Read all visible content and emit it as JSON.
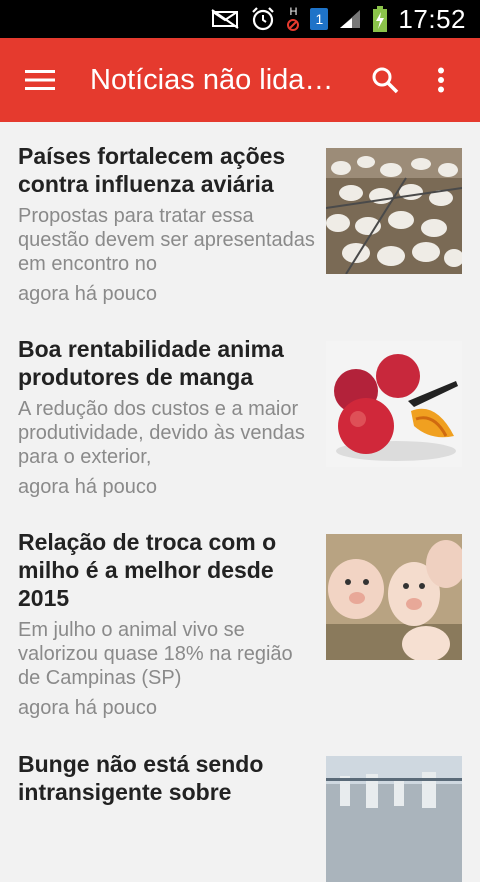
{
  "status_bar": {
    "time": "17:52",
    "sim_number": "1",
    "h_label": "H"
  },
  "app_bar": {
    "title": "Notícias não lida…"
  },
  "articles": [
    {
      "headline": "Países fortalecem ações contra influenza aviária",
      "summary": "Propostas para tratar essa questão devem ser apresentadas em encontro no",
      "time": "agora há pouco"
    },
    {
      "headline": "Boa rentabilidade anima produtores de manga",
      "summary": "A redução dos custos e a maior produtividade, devido às vendas para o exterior,",
      "time": "agora há pouco"
    },
    {
      "headline": "Relação de troca com o milho é a melhor desde 2015",
      "summary": "Em julho o animal vivo se valorizou quase 18% na região de Campinas (SP)",
      "time": "agora há pouco"
    },
    {
      "headline": "Bunge não está sendo intransigente sobre",
      "summary": "",
      "time": ""
    }
  ]
}
